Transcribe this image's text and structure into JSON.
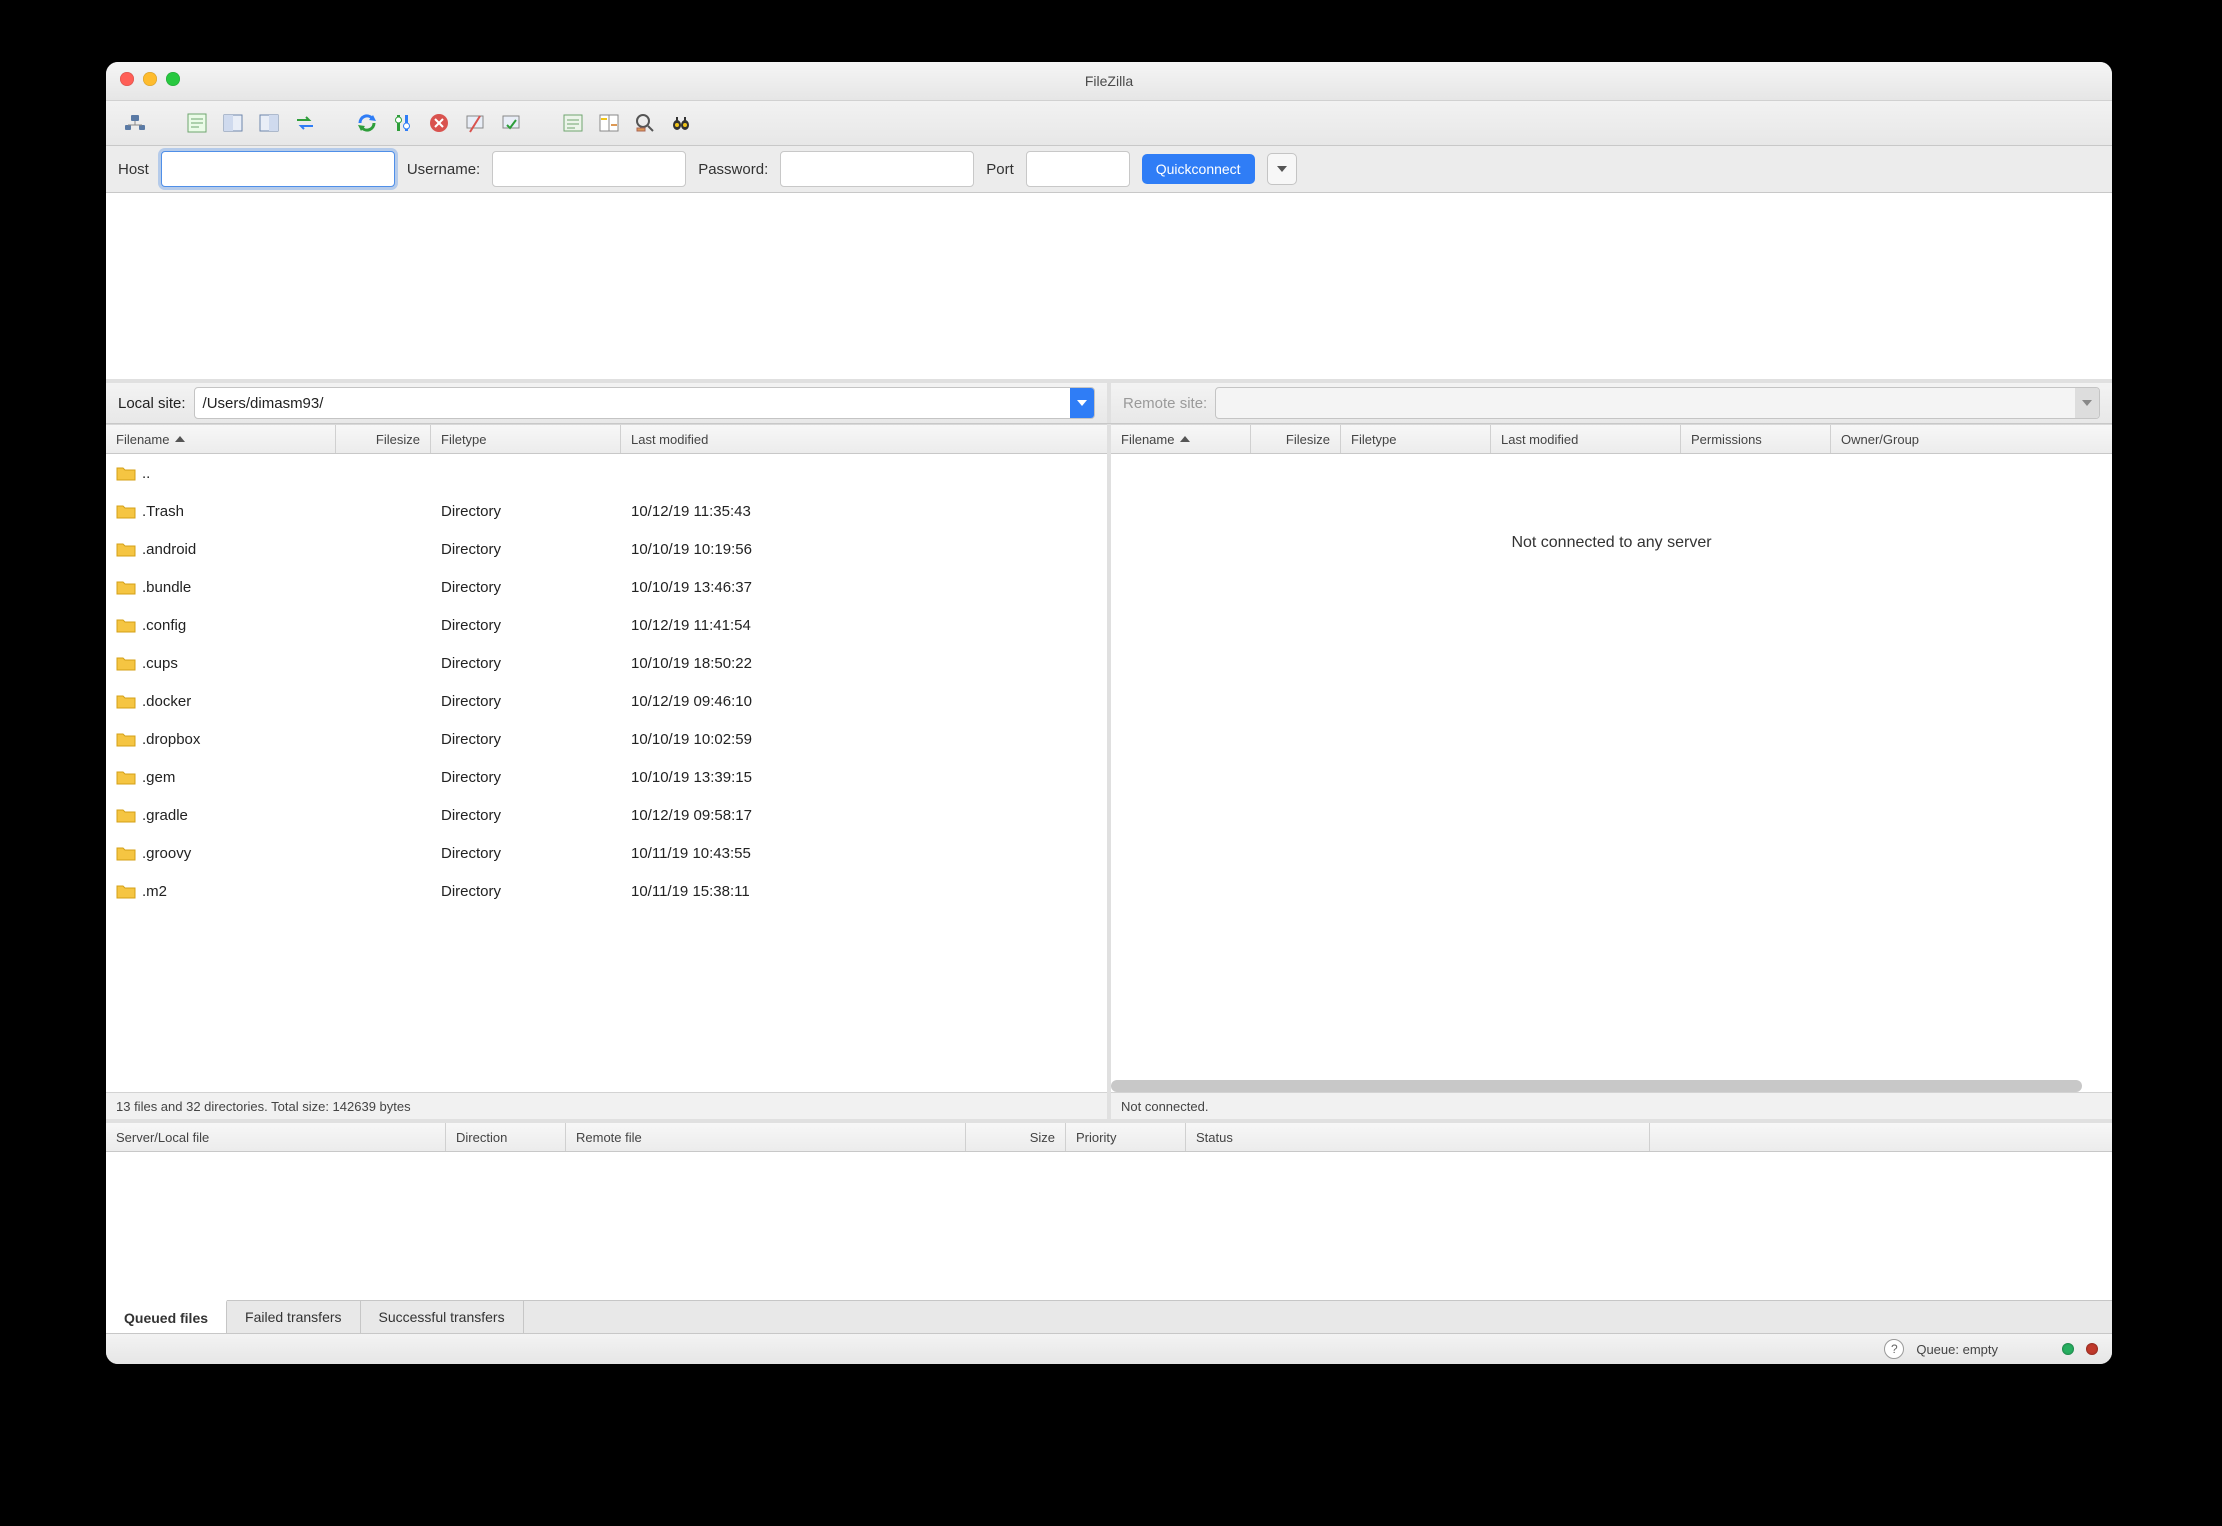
{
  "title": "FileZilla",
  "toolbar_icons": [
    "site-manager-icon",
    "log-toggle-icon",
    "tree-local-icon",
    "tree-remote-icon",
    "sync-browse-icon",
    "refresh-icon",
    "filters-icon",
    "cancel-icon",
    "disconnect-icon",
    "reconnect-icon",
    "queue-process-icon",
    "compare-icon",
    "edit-file-icon",
    "search-icon"
  ],
  "quickbar": {
    "host_label": "Host",
    "host_value": "",
    "username_label": "Username:",
    "username_value": "",
    "password_label": "Password:",
    "password_value": "",
    "port_label": "Port",
    "port_value": "",
    "connect_button": "Quickconnect"
  },
  "local": {
    "label": "Local site:",
    "path": "/Users/dimasm93/",
    "columns": [
      "Filename",
      "Filesize",
      "Filetype",
      "Last modified"
    ],
    "files": [
      {
        "name": "..",
        "size": "",
        "type": "",
        "modified": ""
      },
      {
        "name": ".Trash",
        "size": "",
        "type": "Directory",
        "modified": "10/12/19 11:35:43"
      },
      {
        "name": ".android",
        "size": "",
        "type": "Directory",
        "modified": "10/10/19 10:19:56"
      },
      {
        "name": ".bundle",
        "size": "",
        "type": "Directory",
        "modified": "10/10/19 13:46:37"
      },
      {
        "name": ".config",
        "size": "",
        "type": "Directory",
        "modified": "10/12/19 11:41:54"
      },
      {
        "name": ".cups",
        "size": "",
        "type": "Directory",
        "modified": "10/10/19 18:50:22"
      },
      {
        "name": ".docker",
        "size": "",
        "type": "Directory",
        "modified": "10/12/19 09:46:10"
      },
      {
        "name": ".dropbox",
        "size": "",
        "type": "Directory",
        "modified": "10/10/19 10:02:59"
      },
      {
        "name": ".gem",
        "size": "",
        "type": "Directory",
        "modified": "10/10/19 13:39:15"
      },
      {
        "name": ".gradle",
        "size": "",
        "type": "Directory",
        "modified": "10/12/19 09:58:17"
      },
      {
        "name": ".groovy",
        "size": "",
        "type": "Directory",
        "modified": "10/11/19 10:43:55"
      },
      {
        "name": ".m2",
        "size": "",
        "type": "Directory",
        "modified": "10/11/19 15:38:11"
      }
    ],
    "status": "13 files and 32 directories. Total size: 142639 bytes"
  },
  "remote": {
    "label": "Remote site:",
    "path": "",
    "columns": [
      "Filename",
      "Filesize",
      "Filetype",
      "Last modified",
      "Permissions",
      "Owner/Group"
    ],
    "message": "Not connected to any server",
    "status": "Not connected."
  },
  "queue": {
    "columns": [
      "Server/Local file",
      "Direction",
      "Remote file",
      "Size",
      "Priority",
      "Status"
    ],
    "tabs": [
      "Queued files",
      "Failed transfers",
      "Successful transfers"
    ],
    "active_tab": 0
  },
  "footer": {
    "queue_status": "Queue: empty"
  }
}
